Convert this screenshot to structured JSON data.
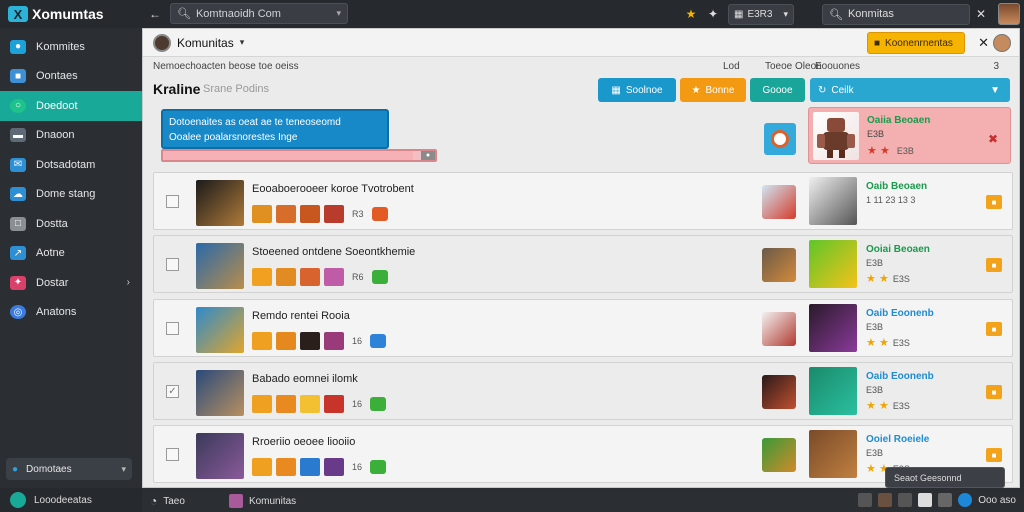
{
  "app": {
    "logo_text": "Xomumtas",
    "logo_glyph": "X"
  },
  "topbar": {
    "search_text": "Komtnaoidh Com",
    "select_value": "E3R3",
    "right_search_text": "Konmitas"
  },
  "sidebar": {
    "items": [
      {
        "label": "Kommites",
        "icon": "users-icon",
        "color": "#1da1d9"
      },
      {
        "label": "Oontaes",
        "icon": "contacts-icon",
        "color": "#3d8fd6"
      },
      {
        "label": "Doedoot",
        "icon": "chat-icon",
        "color": "#1ec28b",
        "active": true
      },
      {
        "label": "Dnaoon",
        "icon": "message-icon",
        "color": "#5e6a75"
      },
      {
        "label": "Dotsadotam",
        "icon": "mail-icon",
        "color": "#2e8fd4"
      },
      {
        "label": "Dome stang",
        "icon": "cloud-icon",
        "color": "#2e8fd4"
      },
      {
        "label": "Dostta",
        "icon": "file-icon",
        "color": "#8a8f94"
      },
      {
        "label": "Aotne",
        "icon": "chart-icon",
        "color": "#2e8fd4"
      },
      {
        "label": "Dostar",
        "icon": "puzzle-icon",
        "color": "#d9406a",
        "has_arrow": true
      },
      {
        "label": "Anatons",
        "icon": "globe-icon",
        "color": "#3b7be0"
      }
    ],
    "footer_label": "Domotaes",
    "bottom_label": "Looodeeatas"
  },
  "header": {
    "title": "Komunitas",
    "notif_label": "Koonenrnentas",
    "subhead": [
      "Nemoechoacten beose toe oeiss",
      "Lod",
      "Toeoe Oleon",
      "Eoouones",
      "3"
    ],
    "page_title": "Kraline",
    "page_sub": "Srane Podins"
  },
  "toolbar": {
    "btn1": "Soolnoe",
    "btn2": "Bonne",
    "btn3": "Goooe",
    "btn4": "Ceilk"
  },
  "tooltip": {
    "line1": "Dotoenaites as oeat ae te teneoseomd",
    "line2": "Ooalee poalarsnorestes Inge"
  },
  "progress": {
    "value": 0.92
  },
  "featured": {
    "name": "Oaiia Beoaen",
    "meta": "E3B",
    "rating_value": "E3B",
    "name_color": "#1a9a4c"
  },
  "rows": [
    {
      "title": "Eooaboerooeer koroe Tvotrobent",
      "count": "R3",
      "rname": "Oaib Beoaen",
      "rname_color": "#1a9a4c",
      "rmeta": "1 11 23 13 3",
      "rating": "",
      "checked": false,
      "thumb": [
        "#1b1b1b",
        "#b07a3a"
      ],
      "mid": [
        "#cfe6f3",
        "#d53b2b"
      ],
      "rthumb": [
        "#f0f0f0",
        "#555"
      ],
      "items": [
        "#e09020",
        "#d76d2a",
        "#c8571f",
        "#b83b2b"
      ],
      "extra": "#e45a24"
    },
    {
      "title": "Stoeened ontdene Soeontkhemie",
      "count": "R6",
      "rname": "Ooiai Beoaen",
      "rname_color": "#1a9a4c",
      "rmeta": "E3B",
      "rating": "E3S",
      "checked": false,
      "thumb": [
        "#2a6aa8",
        "#b88d4a"
      ],
      "mid": [
        "#6a5a4a",
        "#d38a3a"
      ],
      "rthumb": [
        "#5ec62a",
        "#f5c21a"
      ],
      "items": [
        "#f1a020",
        "#e28b22",
        "#d9632e",
        "#c05ba8"
      ],
      "extra": "#3cae3a"
    },
    {
      "title": "Remdo rentei Rooia",
      "count": "16",
      "rname": "Oaib Eoonenb",
      "rname_color": "#1f8ccf",
      "rmeta": "E3B",
      "rating": "E3S",
      "checked": false,
      "thumb": [
        "#2e8acb",
        "#e0a62c"
      ],
      "mid": [
        "#f2f2f2",
        "#b03a30"
      ],
      "rthumb": [
        "#2a1a2a",
        "#8a3a9a"
      ],
      "items": [
        "#f0a020",
        "#e5891f",
        "#2a1f1a",
        "#9b3a7a"
      ],
      "extra": "#2e82d8"
    },
    {
      "title": "Babado eomnei ilomk",
      "count": "16",
      "rname": "Oaib Eoonenb",
      "rname_color": "#1f8ccf",
      "rmeta": "E3B",
      "rating": "E3S",
      "checked": true,
      "thumb": [
        "#2a4a7a",
        "#b89060"
      ],
      "mid": [
        "#2a1a1a",
        "#c05030"
      ],
      "rthumb": [
        "#1a8a6a",
        "#2ac0a0"
      ],
      "items": [
        "#f0a020",
        "#e88a20",
        "#f2c030",
        "#c8342a"
      ],
      "extra": "#3cae3a"
    },
    {
      "title": "Rroeriio oeoee liooiio",
      "count": "16",
      "rname": "Ooiel Roeiele",
      "rname_color": "#1f8ccf",
      "rmeta": "E3B",
      "rating": "E3S",
      "checked": false,
      "thumb": [
        "#3a3a5a",
        "#8a5a9a"
      ],
      "mid": [
        "#3a9a3a",
        "#d08a2a"
      ],
      "rthumb": [
        "#7a4a2a",
        "#c08040"
      ],
      "items": [
        "#f0a020",
        "#e88a20",
        "#2a7ad0",
        "#6a3a8a"
      ],
      "extra": "#3cae3a"
    }
  ],
  "statusbar": {
    "left_label": "Taeo",
    "item_label": "Komunitas",
    "tray_tip": "Seaot Geesonnd",
    "right_label": "Ooo aso"
  },
  "colors": {
    "accent": "#18a999",
    "sidebar_bg": "#2b2f33",
    "topbar_bg": "#26292d",
    "notif": "#f6b400"
  }
}
